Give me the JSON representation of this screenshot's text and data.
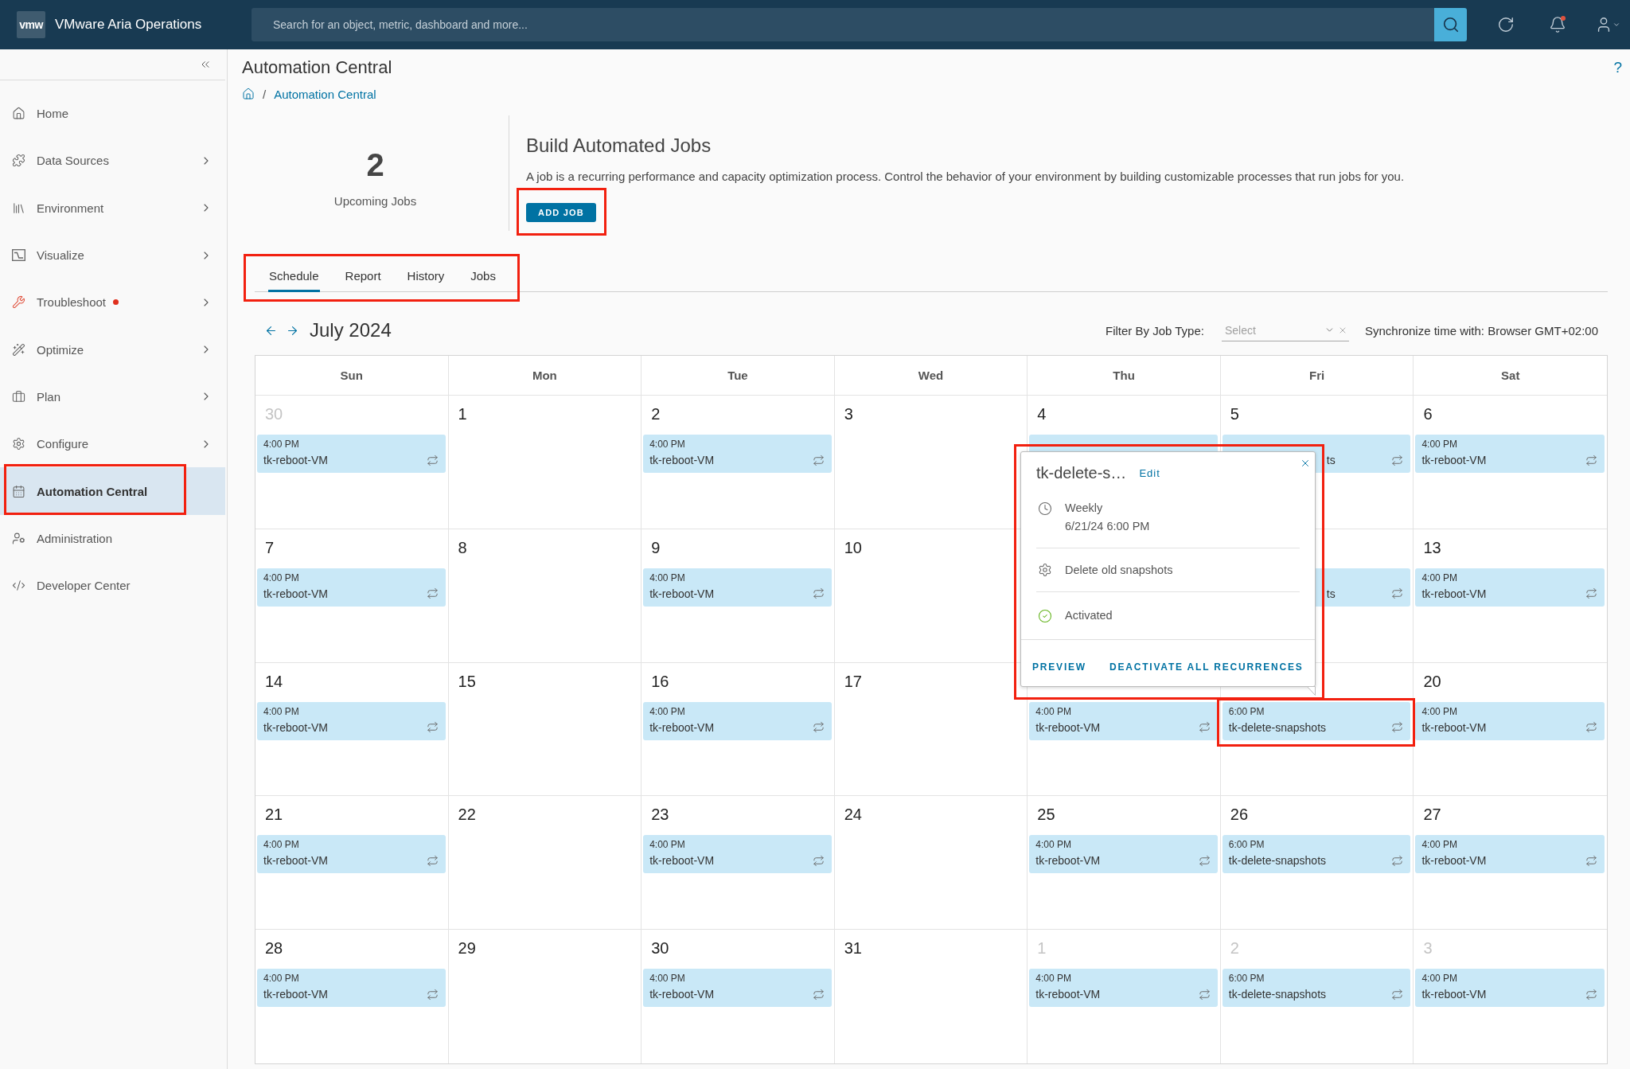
{
  "header": {
    "logo": "vmw",
    "product": "VMware Aria Operations",
    "search": {
      "placeholder": "Search for an object, metric, dashboard and more..."
    },
    "unread_notifications": true
  },
  "sidebar": {
    "items": [
      {
        "label": "Home",
        "expandable": false,
        "alert": false,
        "selected": false,
        "highlighted": false
      },
      {
        "label": "Data Sources",
        "expandable": true,
        "alert": false,
        "selected": false,
        "highlighted": false
      },
      {
        "label": "Environment",
        "expandable": true,
        "alert": false,
        "selected": false,
        "highlighted": false
      },
      {
        "label": "Visualize",
        "expandable": true,
        "alert": false,
        "selected": false,
        "highlighted": false
      },
      {
        "label": "Troubleshoot",
        "expandable": true,
        "alert": true,
        "selected": false,
        "highlighted": false
      },
      {
        "label": "Optimize",
        "expandable": true,
        "alert": false,
        "selected": false,
        "highlighted": false
      },
      {
        "label": "Plan",
        "expandable": true,
        "alert": false,
        "selected": false,
        "highlighted": false
      },
      {
        "label": "Configure",
        "expandable": true,
        "alert": false,
        "selected": false,
        "highlighted": false
      },
      {
        "label": "Automation Central",
        "expandable": false,
        "alert": false,
        "selected": true,
        "highlighted": true
      },
      {
        "label": "Administration",
        "expandable": false,
        "alert": false,
        "selected": false,
        "highlighted": false
      },
      {
        "label": "Developer Center",
        "expandable": false,
        "alert": false,
        "selected": false,
        "highlighted": false
      }
    ]
  },
  "page": {
    "title": "Automation Central",
    "help": "?",
    "breadcrumb": {
      "separator": "/",
      "current": "Automation Central"
    }
  },
  "summary": {
    "count": "2",
    "label": "Upcoming Jobs"
  },
  "intro": {
    "title": "Build Automated Jobs",
    "description": "A job is a recurring performance and capacity optimization process. Control the behavior of your environment by building customizable processes that run jobs for you.",
    "button": {
      "label": "ADD JOB",
      "highlighted": true
    }
  },
  "tabs": {
    "highlighted": true,
    "items": [
      {
        "label": "Schedule",
        "selected": true
      },
      {
        "label": "Report",
        "selected": false
      },
      {
        "label": "History",
        "selected": false
      },
      {
        "label": "Jobs",
        "selected": false
      }
    ]
  },
  "calendar": {
    "month": "July 2024",
    "filter": {
      "label": "Filter By Job Type:",
      "placeholder": "Select"
    },
    "sync": "Synchronize time with: Browser GMT+02:00",
    "weekdays": [
      "Sun",
      "Mon",
      "Tue",
      "Wed",
      "Thu",
      "Fri",
      "Sat"
    ],
    "weeks": [
      {
        "sun": {
          "day": "30",
          "outside": true,
          "events": [
            {
              "time": "4:00 PM",
              "name": "tk-reboot-VM",
              "highlighted": false
            }
          ]
        },
        "mon": {
          "day": "1",
          "outside": false
        },
        "tue": {
          "day": "2",
          "outside": false,
          "events": [
            {
              "time": "4:00 PM",
              "name": "tk-reboot-VM",
              "highlighted": false
            }
          ]
        },
        "wed": {
          "day": "3",
          "outside": false
        },
        "thu": {
          "day": "4",
          "outside": false,
          "events": [
            {
              "highlighted": false
            }
          ]
        },
        "fri": {
          "day": "5",
          "outside": false,
          "events": [
            {
              "name_tail": "ts",
              "highlighted": false
            }
          ]
        },
        "sat": {
          "day": "6",
          "outside": false,
          "events": [
            {
              "time": "4:00 PM",
              "name": "tk-reboot-VM",
              "highlighted": false
            }
          ]
        }
      },
      {
        "sun": {
          "day": "7",
          "outside": false,
          "events": [
            {
              "time": "4:00 PM",
              "name": "tk-reboot-VM",
              "highlighted": false
            }
          ]
        },
        "mon": {
          "day": "8",
          "outside": false
        },
        "tue": {
          "day": "9",
          "outside": false,
          "events": [
            {
              "time": "4:00 PM",
              "name": "tk-reboot-VM",
              "highlighted": false
            }
          ]
        },
        "wed": {
          "day": "10",
          "outside": false
        },
        "fri": {
          "events": [
            {
              "name_tail": "ts",
              "highlighted": false
            }
          ]
        },
        "sat": {
          "day": "13",
          "outside": false,
          "events": [
            {
              "time": "4:00 PM",
              "name": "tk-reboot-VM",
              "highlighted": false
            }
          ]
        }
      },
      {
        "sun": {
          "day": "14",
          "outside": false,
          "events": [
            {
              "time": "4:00 PM",
              "name": "tk-reboot-VM",
              "highlighted": false
            }
          ]
        },
        "mon": {
          "day": "15",
          "outside": false
        },
        "tue": {
          "day": "16",
          "outside": false,
          "events": [
            {
              "time": "4:00 PM",
              "name": "tk-reboot-VM",
              "highlighted": false
            }
          ]
        },
        "wed": {
          "day": "17",
          "outside": false
        },
        "thu": {
          "events": [
            {
              "time": "4:00 PM",
              "name": "tk-reboot-VM",
              "highlighted": false
            }
          ]
        },
        "fri": {
          "events": [
            {
              "time": "6:00 PM",
              "name": "tk-delete-snapshots",
              "highlighted": true
            }
          ]
        },
        "sat": {
          "day": "20",
          "outside": false,
          "events": [
            {
              "time": "4:00 PM",
              "name": "tk-reboot-VM",
              "highlighted": false
            }
          ]
        }
      },
      {
        "sun": {
          "day": "21",
          "outside": false,
          "events": [
            {
              "time": "4:00 PM",
              "name": "tk-reboot-VM",
              "highlighted": false
            }
          ]
        },
        "mon": {
          "day": "22",
          "outside": false
        },
        "tue": {
          "day": "23",
          "outside": false,
          "events": [
            {
              "time": "4:00 PM",
              "name": "tk-reboot-VM",
              "highlighted": false
            }
          ]
        },
        "wed": {
          "day": "24",
          "outside": false
        },
        "thu": {
          "day": "25",
          "outside": false,
          "events": [
            {
              "time": "4:00 PM",
              "name": "tk-reboot-VM",
              "highlighted": false
            }
          ]
        },
        "fri": {
          "day": "26",
          "outside": false,
          "events": [
            {
              "time": "6:00 PM",
              "name": "tk-delete-snapshots",
              "highlighted": false
            }
          ]
        },
        "sat": {
          "day": "27",
          "outside": false,
          "events": [
            {
              "time": "4:00 PM",
              "name": "tk-reboot-VM",
              "highlighted": false
            }
          ]
        }
      },
      {
        "sun": {
          "day": "28",
          "outside": false,
          "events": [
            {
              "time": "4:00 PM",
              "name": "tk-reboot-VM",
              "highlighted": false
            }
          ]
        },
        "mon": {
          "day": "29",
          "outside": false
        },
        "tue": {
          "day": "30",
          "outside": false,
          "events": [
            {
              "time": "4:00 PM",
              "name": "tk-reboot-VM",
              "highlighted": false
            }
          ]
        },
        "wed": {
          "day": "31",
          "outside": false
        },
        "thu": {
          "day": "1",
          "outside": true,
          "events": [
            {
              "time": "4:00 PM",
              "name": "tk-reboot-VM",
              "highlighted": false
            }
          ]
        },
        "fri": {
          "day": "2",
          "outside": true,
          "events": [
            {
              "time": "6:00 PM",
              "name": "tk-delete-snapshots",
              "highlighted": false
            }
          ]
        },
        "sat": {
          "day": "3",
          "outside": true,
          "events": [
            {
              "time": "4:00 PM",
              "name": "tk-reboot-VM",
              "highlighted": false
            }
          ]
        }
      }
    ]
  },
  "popup": {
    "title": "tk-delete-s…",
    "edit": "Edit",
    "recurrence": "Weekly",
    "start": "6/21/24 6:00 PM",
    "action": "Delete old snapshots",
    "status": "Activated",
    "activated": true,
    "buttons": [
      "PREVIEW",
      "DEACTIVATE ALL RECURRENCES"
    ],
    "highlighted": true
  }
}
